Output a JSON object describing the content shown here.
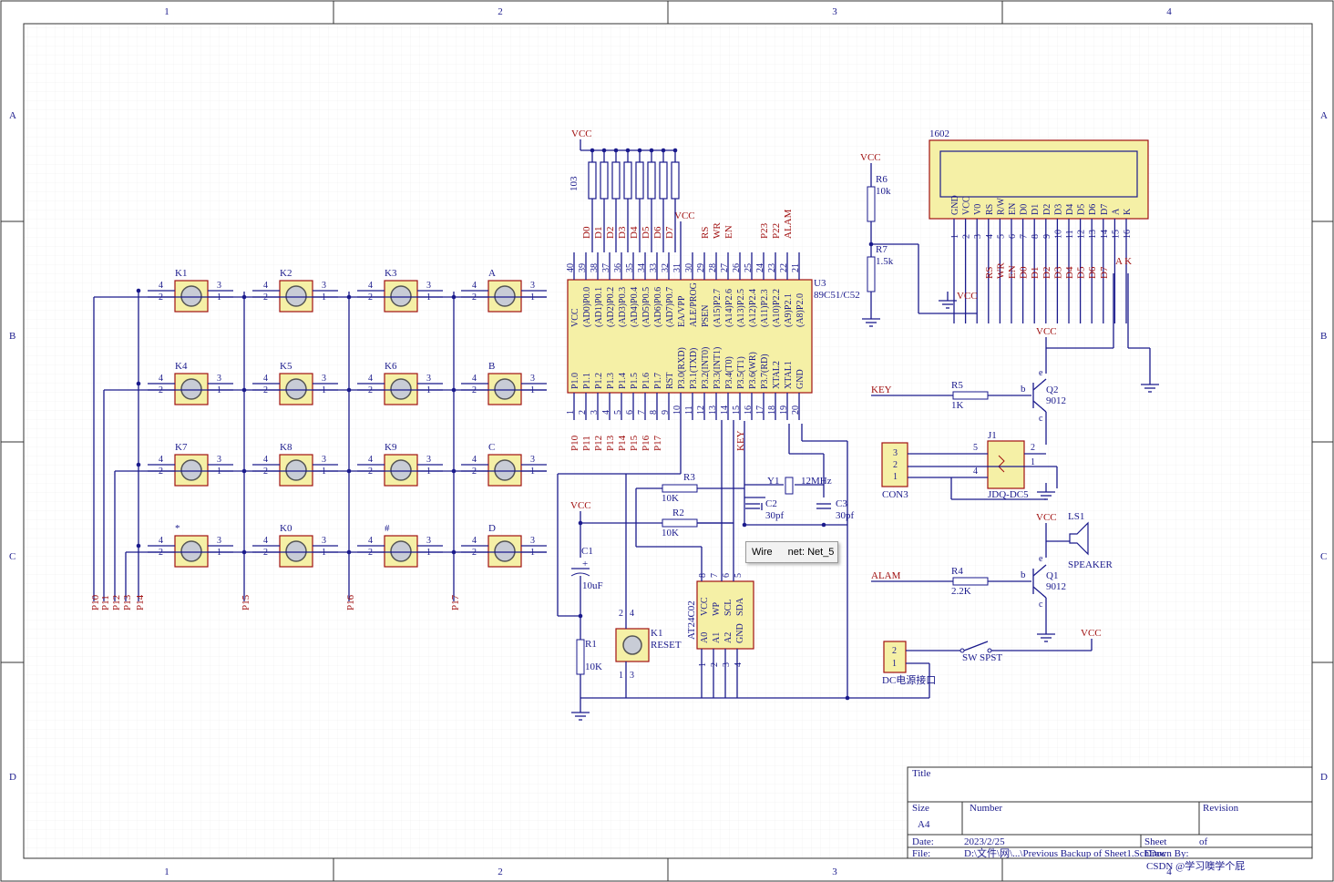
{
  "grid_columns": [
    "1",
    "2",
    "3",
    "4"
  ],
  "grid_rows": [
    "A",
    "B",
    "C",
    "D"
  ],
  "keypad": {
    "keys": [
      {
        "name": "K1",
        "row": 0,
        "col": 0
      },
      {
        "name": "K2",
        "row": 0,
        "col": 1
      },
      {
        "name": "K3",
        "row": 0,
        "col": 2
      },
      {
        "name": "A",
        "row": 0,
        "col": 3
      },
      {
        "name": "K4",
        "row": 1,
        "col": 0
      },
      {
        "name": "K5",
        "row": 1,
        "col": 1
      },
      {
        "name": "K6",
        "row": 1,
        "col": 2
      },
      {
        "name": "B",
        "row": 1,
        "col": 3
      },
      {
        "name": "K7",
        "row": 2,
        "col": 0
      },
      {
        "name": "K8",
        "row": 2,
        "col": 1
      },
      {
        "name": "K9",
        "row": 2,
        "col": 2
      },
      {
        "name": "C",
        "row": 2,
        "col": 3
      },
      {
        "name": "*",
        "row": 3,
        "col": 0
      },
      {
        "name": "K0",
        "row": 3,
        "col": 1
      },
      {
        "name": "#",
        "row": 3,
        "col": 2
      },
      {
        "name": "D",
        "row": 3,
        "col": 3
      }
    ],
    "pin_labels": [
      "4",
      "2",
      "3",
      "1"
    ],
    "row_nets": [
      "P10",
      "P11",
      "P12",
      "P13",
      "P14"
    ],
    "col_nets": [
      "P15",
      "P16",
      "P17"
    ]
  },
  "mcu": {
    "ref": "U3",
    "part": "89C51/C52",
    "left_pins": [
      "P1.0",
      "P1.1",
      "P1.2",
      "P1.3",
      "P1.4",
      "P1.5",
      "P1.6",
      "P1.7",
      "RST",
      "P3.0(RXD)",
      "P3.1(TXD)",
      "P3.2(INT0)",
      "P3.3(INT1)",
      "P3.4(T0)",
      "P3.5(T1)",
      "P3.6(WR)",
      "P3.7(RD)",
      "XTAL2",
      "XTAL1",
      "GND"
    ],
    "left_nums": [
      "1",
      "2",
      "3",
      "4",
      "5",
      "6",
      "7",
      "8",
      "9",
      "10",
      "11",
      "12",
      "13",
      "14",
      "15",
      "16",
      "17",
      "18",
      "19",
      "20"
    ],
    "top_pins": [
      "VCC",
      "(AD0)P0.0",
      "(AD1)P0.1",
      "(AD2)P0.2",
      "(AD3)P0.3",
      "(AD4)P0.4",
      "(AD5)P0.5",
      "(AD6)P0.6",
      "(AD7)P0.7",
      "EA/VPP",
      "ALE/PROG",
      "PSEN",
      "(A15)P2.7",
      "(A14)P2.6",
      "(A13)P2.5",
      "(A12)P2.4",
      "(A11)P2.3",
      "(A10)P2.2",
      "(A9)P2.1",
      "(A8)P2.0"
    ],
    "top_nums": [
      "40",
      "39",
      "38",
      "37",
      "36",
      "35",
      "34",
      "33",
      "32",
      "31",
      "30",
      "29",
      "28",
      "27",
      "26",
      "25",
      "24",
      "23",
      "22",
      "21"
    ],
    "top_nets": [
      "",
      "D0",
      "D1",
      "D2",
      "D3",
      "D4",
      "D5",
      "D6",
      "D7",
      "",
      "",
      "RS",
      "WR",
      "EN",
      "",
      "",
      "P23",
      "P22",
      "ALAM",
      ""
    ],
    "bottom_nets": [
      "P10",
      "P11",
      "P12",
      "P13",
      "P14",
      "P15",
      "P16",
      "P17",
      "",
      "",
      "",
      "",
      "",
      "",
      "KEY",
      "",
      "",
      "",
      "",
      ""
    ]
  },
  "resnet": {
    "ref": "103",
    "vcc": "VCC"
  },
  "lcd": {
    "ref": "1602",
    "pins": [
      "GND",
      "VCC",
      "V0",
      "RS",
      "R/W",
      "EN",
      "D0",
      "D1",
      "D2",
      "D3",
      "D4",
      "D5",
      "D6",
      "D7",
      "A",
      "K"
    ],
    "nums": [
      "1",
      "2",
      "3",
      "4",
      "5",
      "6",
      "7",
      "8",
      "9",
      "10",
      "11",
      "12",
      "13",
      "14",
      "15",
      "16"
    ],
    "nets": [
      "",
      "VCC",
      "",
      "RS",
      "WR",
      "EN",
      "D0",
      "D1",
      "D2",
      "D3",
      "D4",
      "D5",
      "D6",
      "D7",
      "A",
      "K"
    ]
  },
  "labels": {
    "vcc": "VCC",
    "r6": "R6",
    "r6v": "10k",
    "r7": "R7",
    "r7v": "1.5k",
    "key": "KEY",
    "r5": "R5",
    "r5v": "1K",
    "q2": "Q2",
    "q2v": "9012",
    "j1": "J1",
    "j1p": "JDQ-DC5",
    "con3": "CON3",
    "y1": "Y1",
    "y1v": "12MHz",
    "c2": "C2",
    "c2v": "30pf",
    "c3": "C3",
    "c3v": "30pf",
    "r3": "R3",
    "r3v": "10K",
    "r2": "R2",
    "r2v": "10K",
    "c1": "C1",
    "c1v": "10uF",
    "r1": "R1",
    "r1v": "10K",
    "k1": "K1",
    "k1v": "RESET",
    "eeprom": "AT24C02",
    "eeprom_top": [
      "VCC",
      "WP",
      "SCL",
      "SDA"
    ],
    "eeprom_top_n": [
      "8",
      "7",
      "6",
      "5"
    ],
    "eeprom_bot": [
      "A0",
      "A1",
      "A2",
      "GND"
    ],
    "eeprom_bot_n": [
      "1",
      "2",
      "3",
      "4"
    ],
    "alam": "ALAM",
    "r4": "R4",
    "r4v": "2.2K",
    "q1": "Q1",
    "q1v": "9012",
    "ls1": "LS1",
    "speaker": "SPEAKER",
    "dc": "DC电源接口",
    "sw": "SW SPST",
    "ak": "A K",
    "b": "b",
    "c": "c",
    "e": "e"
  },
  "tooltip": {
    "kind": "Wire",
    "net": "net: Net_5"
  },
  "title_block": {
    "title": "Title",
    "size_label": "Size",
    "size": "A4",
    "number": "Number",
    "revision": "Revision",
    "date_label": "Date:",
    "date": "2023/2/25",
    "sheet_label": "Sheet",
    "of": "of",
    "file_label": "File:",
    "file": "D:\\文件\\网\\...\\Previous Backup of Sheet1.SchDoc",
    "drawn": "Drawn By:"
  },
  "watermark": "CSDN @学习噢学个屁"
}
